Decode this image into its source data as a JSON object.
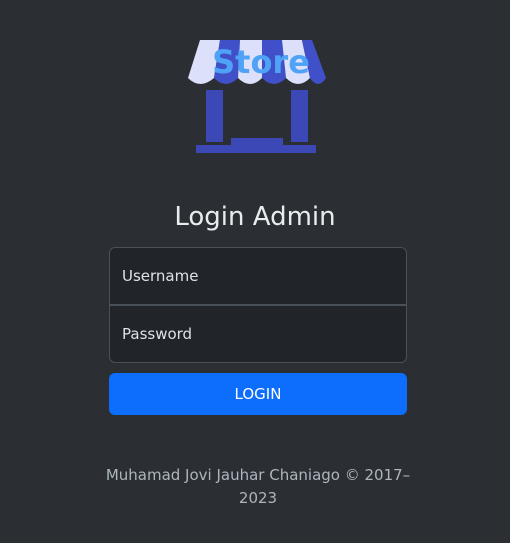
{
  "logo": {
    "text": "Store",
    "icon": "store-icon",
    "colors": {
      "awning_light": "#dde0fb",
      "awning_dark": "#4050c8",
      "text": "#4fa3f7",
      "body": "#3c48b5"
    }
  },
  "header": {
    "title": "Login Admin"
  },
  "form": {
    "username_placeholder": "Username",
    "password_placeholder": "Password",
    "login_label": "LOGIN"
  },
  "footer": {
    "text": "Muhamad Jovi Jauhar Chaniago © 2017–2023"
  },
  "colors": {
    "background": "#2b2f34",
    "input_bg": "#212529",
    "button": "#0d6efd"
  }
}
